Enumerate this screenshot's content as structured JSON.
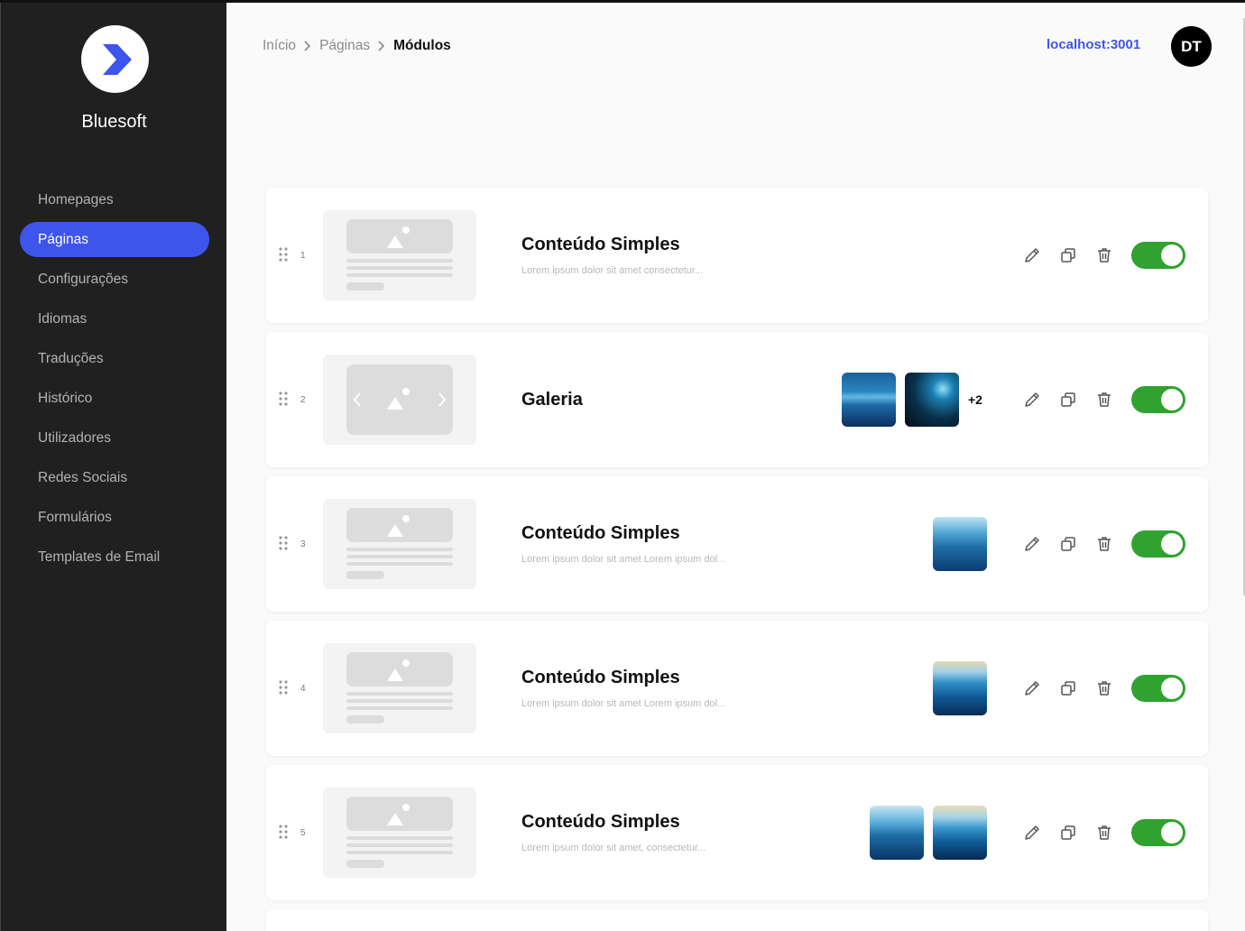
{
  "app": {
    "brand": "Bluesoft"
  },
  "sidebar": {
    "items": [
      {
        "label": "Homepages"
      },
      {
        "label": "Páginas",
        "active": true
      },
      {
        "label": "Configurações"
      },
      {
        "label": "Idiomas"
      },
      {
        "label": "Traduções"
      },
      {
        "label": "Histórico"
      },
      {
        "label": "Utilizadores"
      },
      {
        "label": "Redes Sociais"
      },
      {
        "label": "Formulários"
      },
      {
        "label": "Templates de Email"
      }
    ]
  },
  "header": {
    "breadcrumb": [
      "Início",
      "Páginas",
      "Módulos"
    ],
    "host": "localhost:3001",
    "avatar_initials": "DT"
  },
  "modules": [
    {
      "index": "1",
      "title": "Conteúdo Simples",
      "description": "Lorem ipsum dolor sit amet consectetur...",
      "thumb_type": "content",
      "images": [],
      "more": "",
      "enabled": true
    },
    {
      "index": "2",
      "title": "Galeria",
      "description": "",
      "thumb_type": "gallery",
      "images": [
        "ocean-surface",
        "underwater-cave"
      ],
      "more": "+2",
      "enabled": true
    },
    {
      "index": "3",
      "title": "Conteúdo Simples",
      "description": "Lorem ipsum dolor sit amet Lorem ipsum dol...",
      "thumb_type": "content",
      "images": [
        "ocean-surface"
      ],
      "more": "",
      "enabled": true
    },
    {
      "index": "4",
      "title": "Conteúdo Simples",
      "description": "Lorem ipsum dolor sit amet Lorem ipsum dol...",
      "thumb_type": "content",
      "images": [
        "ocean-sunrise"
      ],
      "more": "",
      "enabled": true
    },
    {
      "index": "5",
      "title": "Conteúdo Simples",
      "description": "Lorem ipsum dolor sit amet, consectetur...",
      "thumb_type": "content",
      "images": [
        "ocean-surface",
        "ocean-sunrise"
      ],
      "more": "",
      "enabled": true
    }
  ],
  "colors": {
    "accent": "#3d55ea",
    "sidebar_bg": "#202020",
    "toggle_on": "#30a22f"
  }
}
